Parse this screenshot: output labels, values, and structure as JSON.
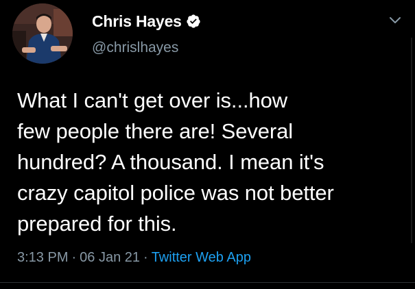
{
  "tweet": {
    "author": {
      "display_name": "Chris Hayes",
      "handle": "@chrislhayes",
      "verified_icon": "verified-badge-icon",
      "avatar_icon": "avatar"
    },
    "menu_icon": "chevron-down-icon",
    "text_lines": [
      "What I can't get over is...how",
      "few people there are! Several",
      "hundred? A thousand. I mean it's",
      "crazy capitol police was not better",
      "prepared for this."
    ],
    "time": "3:13 PM",
    "date": "06 Jan 21",
    "separator": "·",
    "source": "Twitter Web App"
  },
  "colors": {
    "background": "#000000",
    "text": "#ffffff",
    "secondary": "#8899a6",
    "link": "#1da1f2"
  }
}
